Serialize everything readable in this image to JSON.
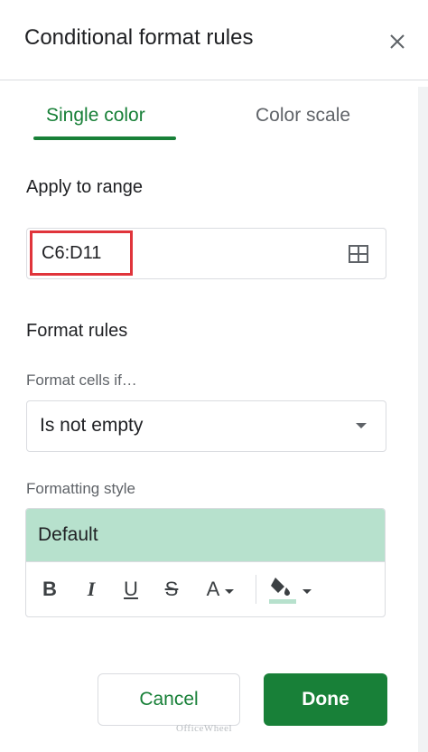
{
  "panel": {
    "title": "Conditional format rules",
    "close_icon": "close-icon"
  },
  "tabs": [
    {
      "label": "Single color",
      "active": true
    },
    {
      "label": "Color scale",
      "active": false
    }
  ],
  "apply_to_range": {
    "label": "Apply to range",
    "value": "C6:D11",
    "icon": "select-range-grid-icon"
  },
  "format_rules": {
    "heading": "Format rules",
    "condition_label": "Format cells if…",
    "condition_value": "Is not empty"
  },
  "formatting_style": {
    "label": "Formatting style",
    "preview_label": "Default",
    "preview_color": "#b7e1cd",
    "toolbar": {
      "bold": "B",
      "italic": "I",
      "underline": "U",
      "strikethrough": "S",
      "text_color": "A",
      "fill_color_icon": "paint-bucket-icon",
      "fill_color_swatch": "#b7e1cd"
    }
  },
  "actions": {
    "cancel_label": "Cancel",
    "done_label": "Done"
  },
  "watermark": "OfficeWheel",
  "colors": {
    "accent": "#188038",
    "highlight_border": "#e0343b"
  }
}
